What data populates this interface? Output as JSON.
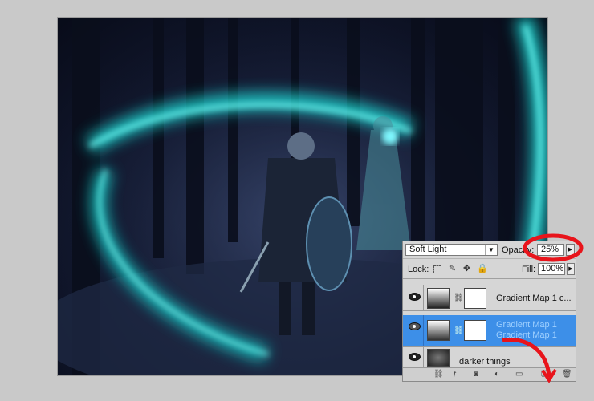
{
  "canvas": {
    "subject": ""
  },
  "layers_panel": {
    "blend_mode": "Soft Light",
    "opacity_label": "Opacity:",
    "opacity_value": "25%",
    "lock_label": "Lock:",
    "fill_label": "Fill:",
    "fill_value": "100%",
    "layers": [
      {
        "name": "Gradient Map 1 c...",
        "visible": true,
        "selected": false
      },
      {
        "name": "Gradient Map 1",
        "name2": "Gradient Map 1",
        "visible": true,
        "selected": true
      },
      {
        "name": "darker things",
        "visible": true,
        "selected": false
      }
    ]
  },
  "colors": {
    "selection": "#3d8fe8",
    "annotation": "#e8141b",
    "glow": "#2ee8e0"
  },
  "icons": {
    "lock_transparent": "checker-icon",
    "lock_pixels": "brush-icon",
    "lock_position": "move-icon",
    "lock_all": "padlock-icon"
  }
}
